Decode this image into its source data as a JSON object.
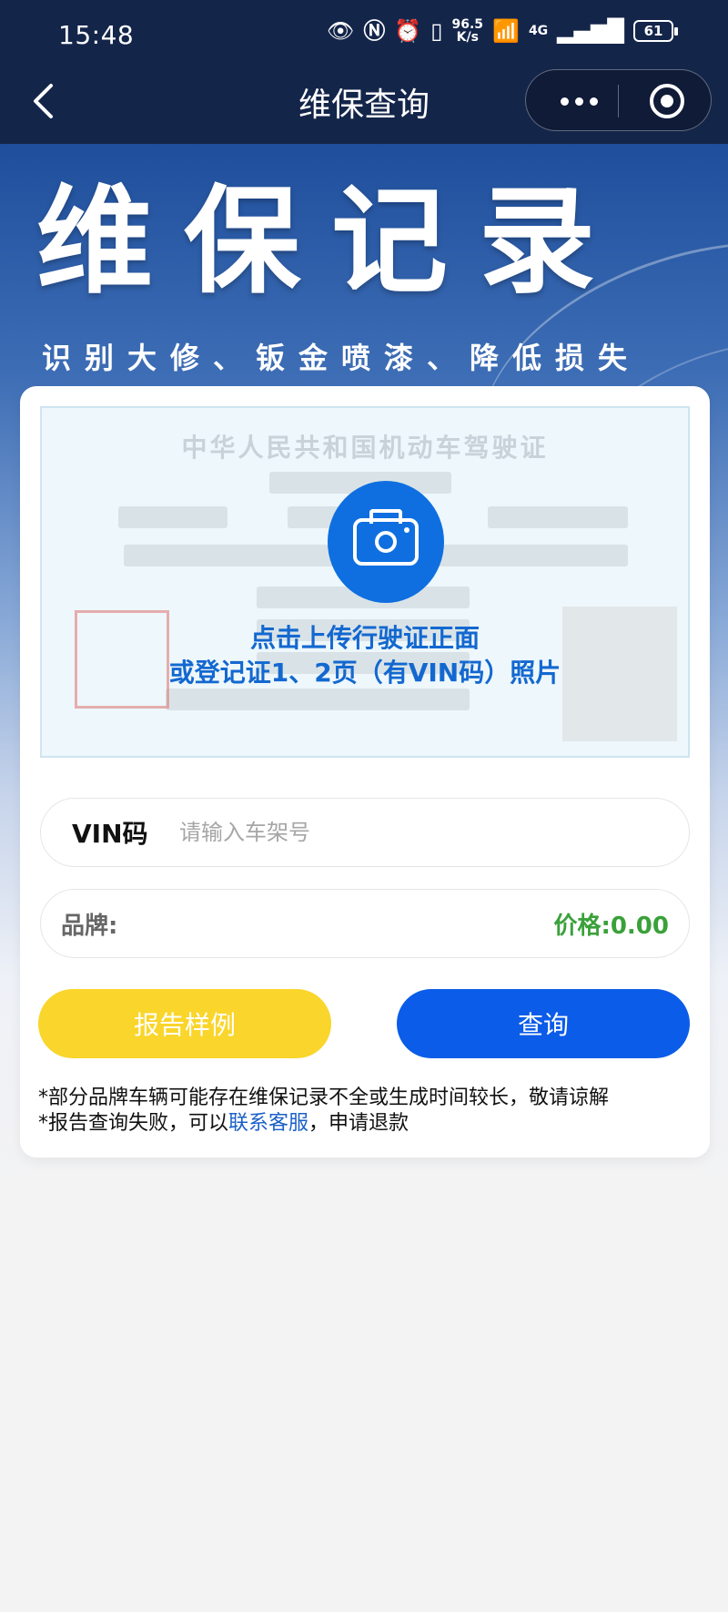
{
  "status_bar": {
    "time": "15:48",
    "net_speed_value": "96.5",
    "net_speed_unit": "K/s",
    "network": "4G",
    "battery": "61"
  },
  "nav": {
    "title": "维保查询"
  },
  "hero": {
    "title": "维保记录",
    "subtitle": "识别大修、钣金喷漆、降低损失"
  },
  "upload": {
    "license_title": "中华人民共和国机动车驾驶证",
    "hint_line1": "点击上传行驶证正面",
    "hint_line2": "或登记证1、2页（有VIN码）照片"
  },
  "vin": {
    "label": "VIN码",
    "placeholder": "请输入车架号",
    "value": ""
  },
  "brand": {
    "label": "品牌:",
    "value": "",
    "price_label": "价格:",
    "price_value": "0.00"
  },
  "buttons": {
    "sample": "报告样例",
    "query": "查询"
  },
  "notes": {
    "line1": "*部分品牌车辆可能存在维保记录不全或生成时间较长，敬请谅解",
    "line2_prefix": "*报告查询失败，可以",
    "line2_link": "联系客服",
    "line2_suffix": "，申请退款"
  },
  "colors": {
    "nav_bg": "#14254a",
    "accent_blue": "#0b5ce8",
    "sample_yellow": "#fad52b",
    "price_green": "#3aa13a",
    "link_blue": "#1a60c8"
  }
}
